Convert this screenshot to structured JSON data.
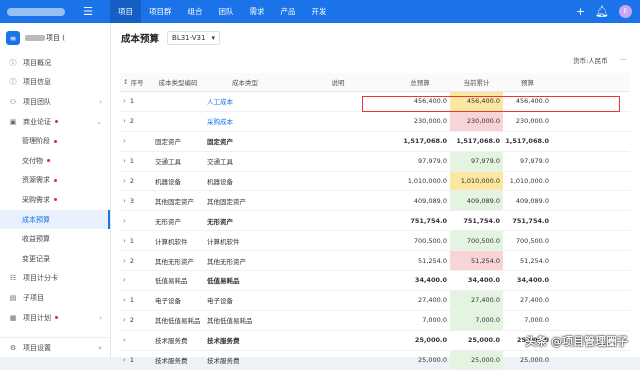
{
  "topbar": {
    "nav": [
      "项目",
      "项目群",
      "组合",
      "团队",
      "需求",
      "产品",
      "开发"
    ],
    "active_index": 0,
    "avatar_text": "E"
  },
  "sidebar": {
    "project_icon": "≡",
    "project_name_suffix": "项目 (",
    "items": [
      {
        "label": "项目概况",
        "icon": "info-icon"
      },
      {
        "label": "项目信息",
        "icon": "info-icon"
      },
      {
        "label": "项目团队",
        "icon": "team-icon",
        "arrow": true
      },
      {
        "label": "商业论证",
        "icon": "business-icon",
        "arrow": true,
        "dot": true
      },
      {
        "label": "管理阶段",
        "sub": true,
        "dot": true
      },
      {
        "label": "交付物",
        "sub": true,
        "dot": true
      },
      {
        "label": "资源需求",
        "sub": true,
        "dot": true
      },
      {
        "label": "采购需求",
        "sub": true,
        "dot": true
      },
      {
        "label": "成本预算",
        "sub": true,
        "active": true
      },
      {
        "label": "收益预算",
        "sub": true
      },
      {
        "label": "变更记录",
        "sub": true
      },
      {
        "label": "项目计分卡",
        "icon": "scorecard-icon"
      },
      {
        "label": "子项目",
        "icon": "subproject-icon"
      },
      {
        "label": "项目计划",
        "icon": "plan-icon",
        "arrow": true,
        "dot": true
      }
    ],
    "settings_label": "项目设置",
    "collapse_icon": "«"
  },
  "header": {
    "title": "成本预算",
    "version": "BL31-V31",
    "currency": "货币:人民币",
    "more": "···"
  },
  "table": {
    "headers": [
      "序号",
      "成本类型编码",
      "成本类型",
      "说明",
      "总预算",
      "当前累计",
      "预算"
    ],
    "rows": [
      {
        "no": "1",
        "code": "",
        "type": "人工成本",
        "desc": "",
        "total": "456,400.0",
        "current": "456,400.0",
        "budget": "456,400.0",
        "link": true,
        "hl": "yellow",
        "exp": true
      },
      {
        "no": "2",
        "code": "",
        "type": "采购成本",
        "desc": "",
        "total": "230,000.0",
        "current": "230,000.0",
        "budget": "230,000.0",
        "link": true,
        "hl": "red",
        "exp": true
      },
      {
        "no": "",
        "code": "固定资产",
        "type": "固定资产",
        "desc": "",
        "total": "1,517,068.0",
        "current": "1,517,068.0",
        "budget": "1,517,068.0",
        "bold": true,
        "exp": true
      },
      {
        "no": "1",
        "code": "交通工具",
        "type": "交通工具",
        "desc": "",
        "total": "97,979.0",
        "current": "97,979.0",
        "budget": "97,979.0",
        "hl": "green",
        "exp": true
      },
      {
        "no": "2",
        "code": "机器设备",
        "type": "机器设备",
        "desc": "",
        "total": "1,010,000.0",
        "current": "1,010,000.0",
        "budget": "1,010,000.0",
        "hl": "yellow",
        "exp": true
      },
      {
        "no": "3",
        "code": "其他固定资产",
        "type": "其他固定资产",
        "desc": "",
        "total": "409,089.0",
        "current": "409,089.0",
        "budget": "409,089.0",
        "hl": "green",
        "exp": true
      },
      {
        "no": "",
        "code": "无形资产",
        "type": "无形资产",
        "desc": "",
        "total": "751,754.0",
        "current": "751,754.0",
        "budget": "751,754.0",
        "bold": true,
        "exp": true
      },
      {
        "no": "1",
        "code": "计算机软件",
        "type": "计算机软件",
        "desc": "",
        "total": "700,500.0",
        "current": "700,500.0",
        "budget": "700,500.0",
        "hl": "green",
        "exp": true
      },
      {
        "no": "2",
        "code": "其他无形资产",
        "type": "其他无形资产",
        "desc": "",
        "total": "51,254.0",
        "current": "51,254.0",
        "budget": "51,254.0",
        "hl": "red",
        "exp": true
      },
      {
        "no": "",
        "code": "低值易耗品",
        "type": "低值易耗品",
        "desc": "",
        "total": "34,400.0",
        "current": "34,400.0",
        "budget": "34,400.0",
        "bold": true,
        "exp": true
      },
      {
        "no": "1",
        "code": "电子设备",
        "type": "电子设备",
        "desc": "",
        "total": "27,400.0",
        "current": "27,400.0",
        "budget": "27,400.0",
        "hl": "green",
        "exp": true
      },
      {
        "no": "2",
        "code": "其他低值易耗品",
        "type": "其他低值易耗品",
        "desc": "",
        "total": "7,000.0",
        "current": "7,000.0",
        "budget": "7,000.0",
        "hl": "green",
        "exp": true
      },
      {
        "no": "",
        "code": "技术服务费",
        "type": "技术服务费",
        "desc": "",
        "total": "25,000.0",
        "current": "25,000.0",
        "budget": "25,000.0",
        "bold": true,
        "exp": true
      },
      {
        "no": "1",
        "code": "技术服务费",
        "type": "技术服务费",
        "desc": "",
        "total": "25,000.0",
        "current": "25,000.0",
        "budget": "25,000.0",
        "hl": "green",
        "exp": true
      }
    ]
  },
  "watermark": "头条 @项目管理圈子",
  "colors": {
    "accent": "#1a73e8",
    "highlight_yellow": "#fbe7a2",
    "highlight_red": "#f9d4d7",
    "highlight_green": "#e3f4e1",
    "box": "#e53935"
  }
}
